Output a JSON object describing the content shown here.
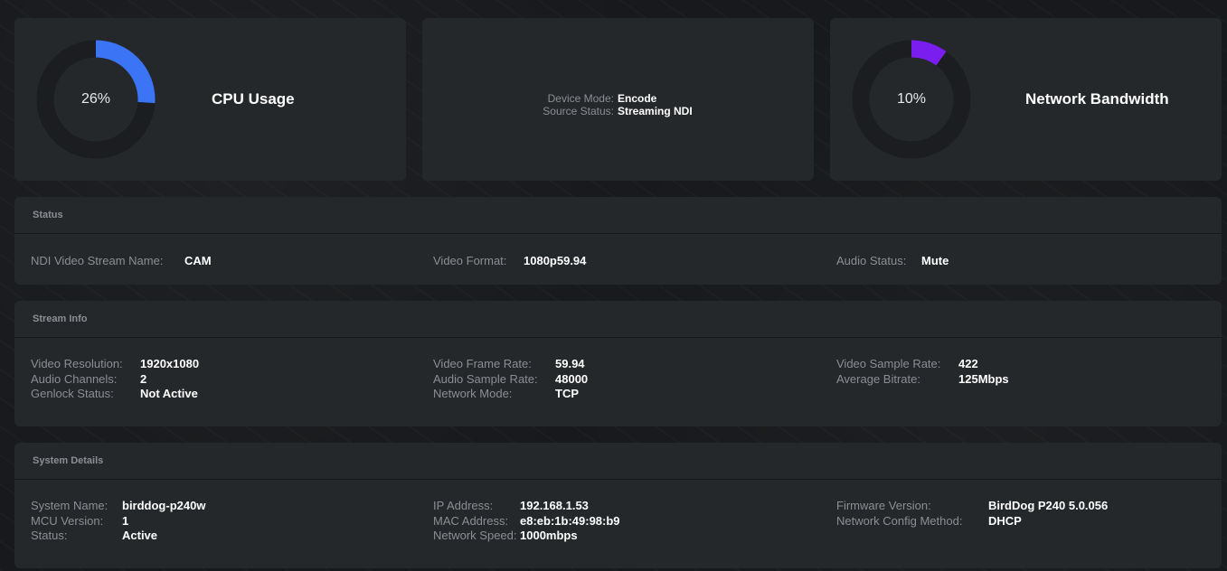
{
  "cpu": {
    "value": "26%",
    "level": 0.26,
    "title": "CPU Usage",
    "color": "#3b74f5"
  },
  "mode": {
    "device_mode_label": "Device Mode:",
    "device_mode": "Encode",
    "source_status_label": "Source Status:",
    "source_status": "Streaming NDI"
  },
  "network": {
    "value": "10%",
    "level": 0.1,
    "title": "Network Bandwidth",
    "color": "#7a1ef0"
  },
  "status": {
    "title": "Status",
    "ndi_label": "NDI Video Stream Name:",
    "ndi": "CAM",
    "format_label": "Video Format:",
    "format": "1080p59.94",
    "audio_label": "Audio Status:",
    "audio": "Mute"
  },
  "stream": {
    "title": "Stream Info",
    "resolution_label": "Video Resolution:",
    "resolution": "1920x1080",
    "audio_channels_label": "Audio Channels:",
    "audio_channels": "2",
    "genlock_label": "Genlock Status:",
    "genlock": "Not Active",
    "frame_rate_label": "Video Frame Rate:",
    "frame_rate": "59.94",
    "audio_sample_label": "Audio Sample Rate:",
    "audio_sample": "48000",
    "network_mode_label": "Network Mode:",
    "network_mode": "TCP",
    "video_sample_label": "Video Sample Rate:",
    "video_sample": "422",
    "bitrate_label": "Average Bitrate:",
    "bitrate": "125Mbps"
  },
  "system": {
    "title": "System Details",
    "name_label": "System Name:",
    "name": "birddog-p240w",
    "mcu_label": "MCU Version:",
    "mcu": "1",
    "status_label": "Status:",
    "status": "Active",
    "ip_label": "IP Address:",
    "ip": "192.168.1.53",
    "mac_label": "MAC Address:",
    "mac": "e8:eb:1b:49:98:b9",
    "speed_label": "Network Speed:",
    "speed": "1000mbps",
    "firmware_label": "Firmware Version:",
    "firmware": "BirdDog P240 5.0.056",
    "config_label": "Network Config Method:",
    "config": "DHCP"
  }
}
